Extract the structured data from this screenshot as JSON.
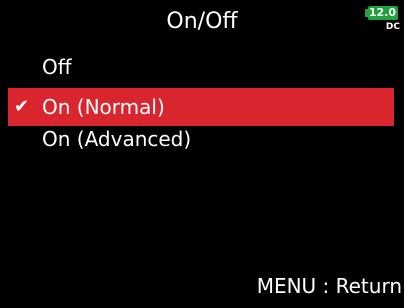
{
  "header": {
    "title": "On/Off",
    "battery_level": "12.0",
    "power_source": "DC",
    "battery_color": "#1fa23a"
  },
  "menu": {
    "items": [
      {
        "label": "Off",
        "selected": false
      },
      {
        "label": "On (Normal)",
        "selected": true
      },
      {
        "label": "On (Advanced)",
        "selected": false
      }
    ],
    "selection_color": "#d8252e",
    "check_icon": "check-icon"
  },
  "footer": {
    "hint": "MENU : Return"
  }
}
